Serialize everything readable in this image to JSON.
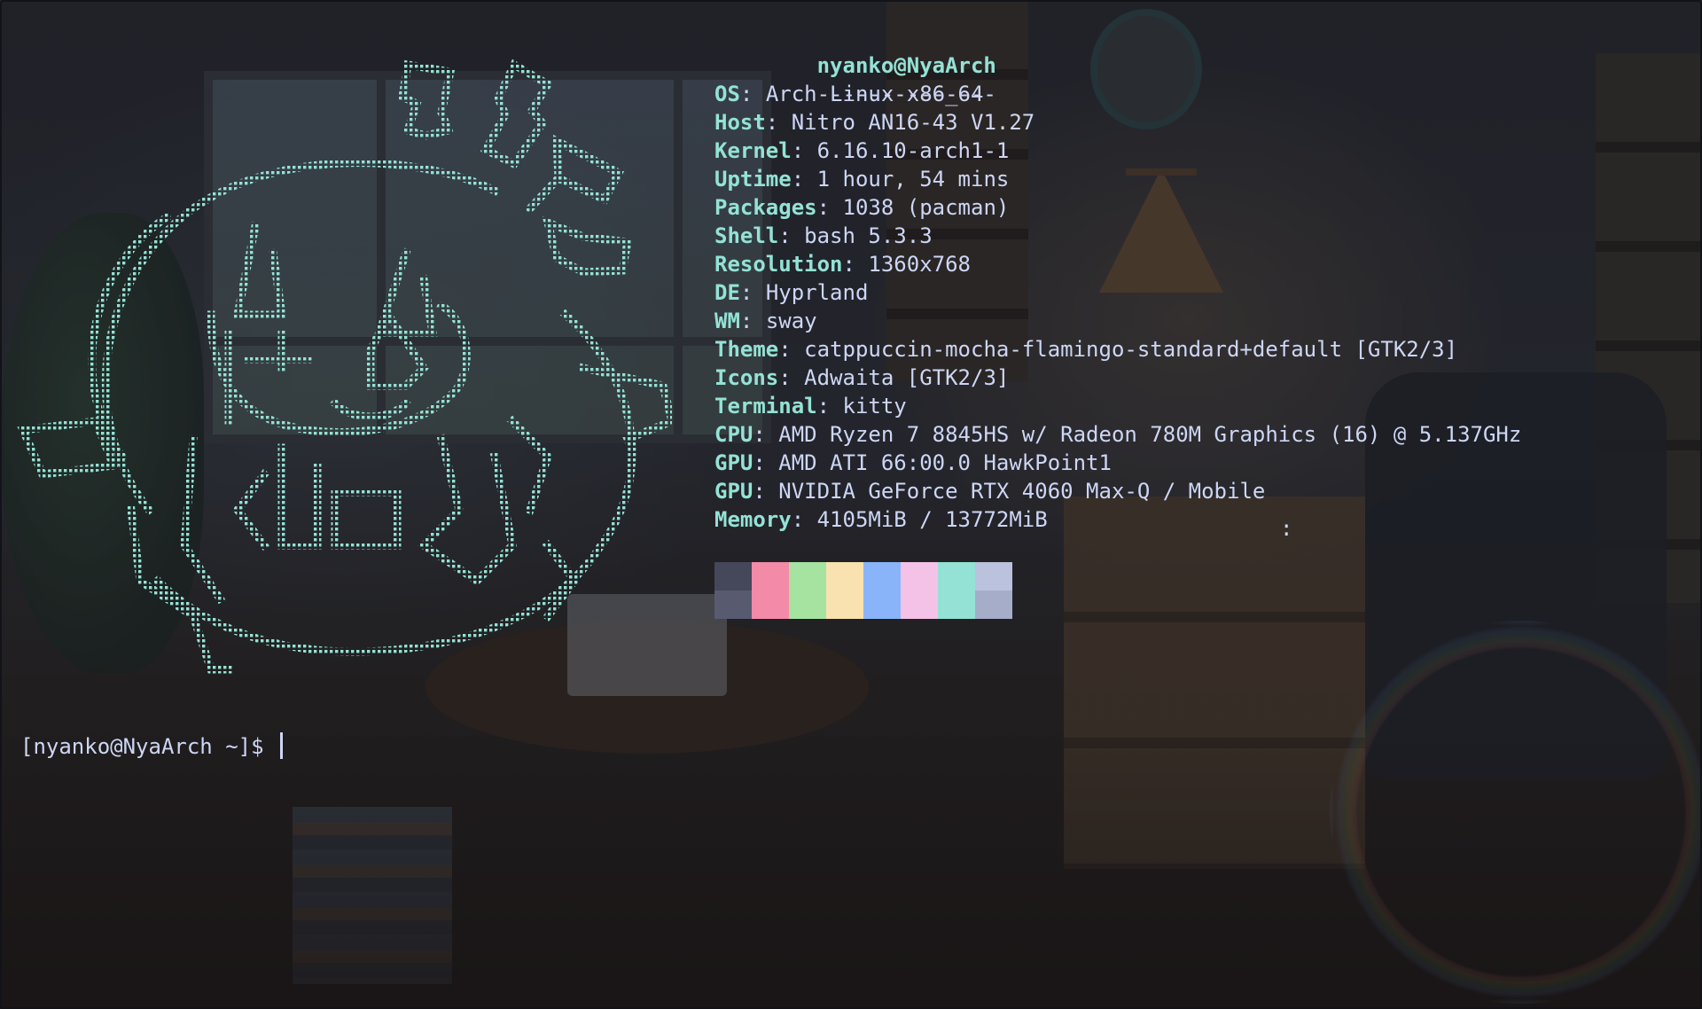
{
  "terminal": {
    "title_line": "nyanko@NyaArch",
    "separator": "--------------",
    "info": [
      {
        "key": "OS",
        "value": "Arch Linux x86_64"
      },
      {
        "key": "Host",
        "value": "Nitro AN16-43 V1.27"
      },
      {
        "key": "Kernel",
        "value": "6.16.10-arch1-1"
      },
      {
        "key": "Uptime",
        "value": "1 hour, 54 mins"
      },
      {
        "key": "Packages",
        "value": "1038 (pacman)"
      },
      {
        "key": "Shell",
        "value": "bash 5.3.3"
      },
      {
        "key": "Resolution",
        "value": "1360x768"
      },
      {
        "key": "DE",
        "value": "Hyprland"
      },
      {
        "key": "WM",
        "value": "sway"
      },
      {
        "key": "Theme",
        "value": "catppuccin-mocha-flamingo-standard+default [GTK2/3]"
      },
      {
        "key": "Icons",
        "value": "Adwaita [GTK2/3]"
      },
      {
        "key": "Terminal",
        "value": "kitty"
      },
      {
        "key": "CPU",
        "value": "AMD Ryzen 7 8845HS w/ Radeon 780M Graphics (16) @ 5.137GHz"
      },
      {
        "key": "GPU",
        "value": "AMD ATI 66:00.0 HawkPoint1"
      },
      {
        "key": "GPU",
        "value": "NVIDIA GeForce RTX 4060 Max-Q / Mobile"
      },
      {
        "key": "Memory",
        "value": "4105MiB / 13772MiB"
      }
    ],
    "palette": [
      {
        "top": "#45475a",
        "bottom": "#585b70"
      },
      {
        "top": "#f38ba8",
        "bottom": "#f38ba8"
      },
      {
        "top": "#a6e3a1",
        "bottom": "#a6e3a1"
      },
      {
        "top": "#f9e2af",
        "bottom": "#f9e2af"
      },
      {
        "top": "#89b4fa",
        "bottom": "#89b4fa"
      },
      {
        "top": "#f5c2e7",
        "bottom": "#f5c2e7"
      },
      {
        "top": "#94e2d5",
        "bottom": "#94e2d5"
      },
      {
        "top": "#bac2de",
        "bottom": "#a6adc8"
      }
    ],
    "prompt": "[nyanko@NyaArch ~]$ ",
    "stray_char": ":",
    "logo_icon": "dotted-cat-logo-icon"
  },
  "colors": {
    "accent": "#94e2d5",
    "text": "#cdd6f4"
  }
}
